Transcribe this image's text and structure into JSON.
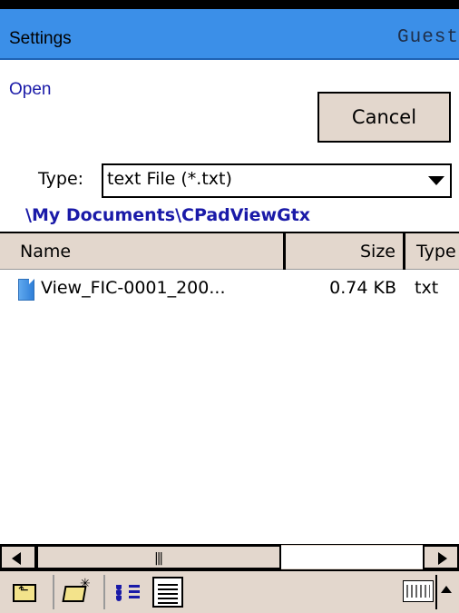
{
  "titlebar": {
    "title": "Settings",
    "user": "Guest"
  },
  "dialog": {
    "heading": "Open",
    "cancel_label": "Cancel",
    "type_label": "Type:",
    "type_value": "text File (*.txt)",
    "path": "\\My Documents\\CPadViewGtx"
  },
  "file_list": {
    "columns": [
      "Name",
      "Size",
      "Type"
    ],
    "rows": [
      {
        "name": "View_FIC-0001_200...",
        "size": "0.74 KB",
        "type": "txt"
      }
    ]
  },
  "toolbar": {
    "icons": [
      "up-folder-icon",
      "new-folder-icon",
      "list-view-icon",
      "details-view-icon",
      "keyboard-icon",
      "input-panel-arrow-icon"
    ]
  },
  "colors": {
    "titlebar": "#3b8fe8",
    "accent_text": "#1a1aa8",
    "button_face": "#e3d7cd"
  }
}
